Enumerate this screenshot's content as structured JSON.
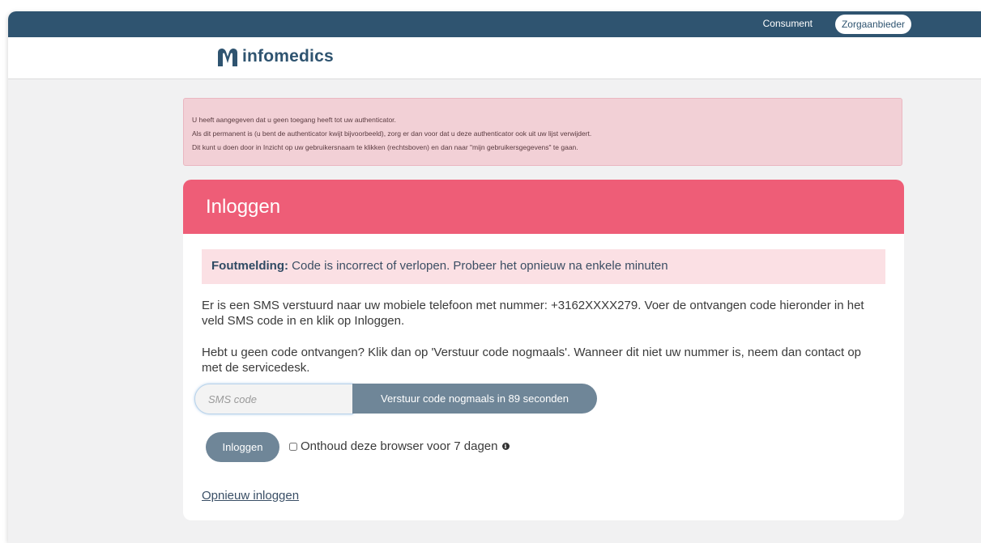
{
  "topbar": {
    "consument_label": "Consument",
    "zorgaanbieder_label": "Zorgaanbieder"
  },
  "header": {
    "logo_text": "infomedics"
  },
  "notice": {
    "lines": [
      "U heeft aangegeven dat u geen toegang heeft tot uw authenticator.",
      "Als dit permanent is (u bent de authenticator kwijt bijvoorbeeld), zorg er dan voor dat u deze authenticator ook uit uw lijst verwijdert.",
      "Dit kunt u doen door in Inzicht op uw gebruikersnaam te klikken (rechtsboven) en dan naar \"mijn gebruikersgegevens\" te gaan."
    ]
  },
  "login_card": {
    "title": "Inloggen",
    "error_label": "Foutmelding:",
    "error_text": " Code is incorrect of verlopen. Probeer het opnieuw na enkele minuten",
    "sms_info": "Er is een SMS verstuurd naar uw mobiele telefoon met nummer: +3162XXXX279. Voer de ontvangen code hieronder in het veld SMS code in en klik op Inloggen.",
    "no_code_info": "Hebt u geen code ontvangen? Klik dan op 'Verstuur code nogmaals'. Wanneer dit niet uw nummer is, neem dan contact op met de servicedesk.",
    "sms_placeholder": "SMS code",
    "sms_value": "",
    "resend_label": "Verstuur code nogmaals in 89 seconden",
    "login_label": "Inloggen",
    "remember_label": "Onthoud deze browser voor 7 dagen",
    "remember_checked": false,
    "relogin_label": "Opnieuw inloggen"
  },
  "colors": {
    "topbar": "#2f5470",
    "card_header": "#ee5d77",
    "button": "#6f8698",
    "notice_bg": "#f2d0d6",
    "error_bg": "#fbe0e4"
  },
  "icons": {
    "logo": "infomedics-logo-icon",
    "info": "info-icon"
  }
}
